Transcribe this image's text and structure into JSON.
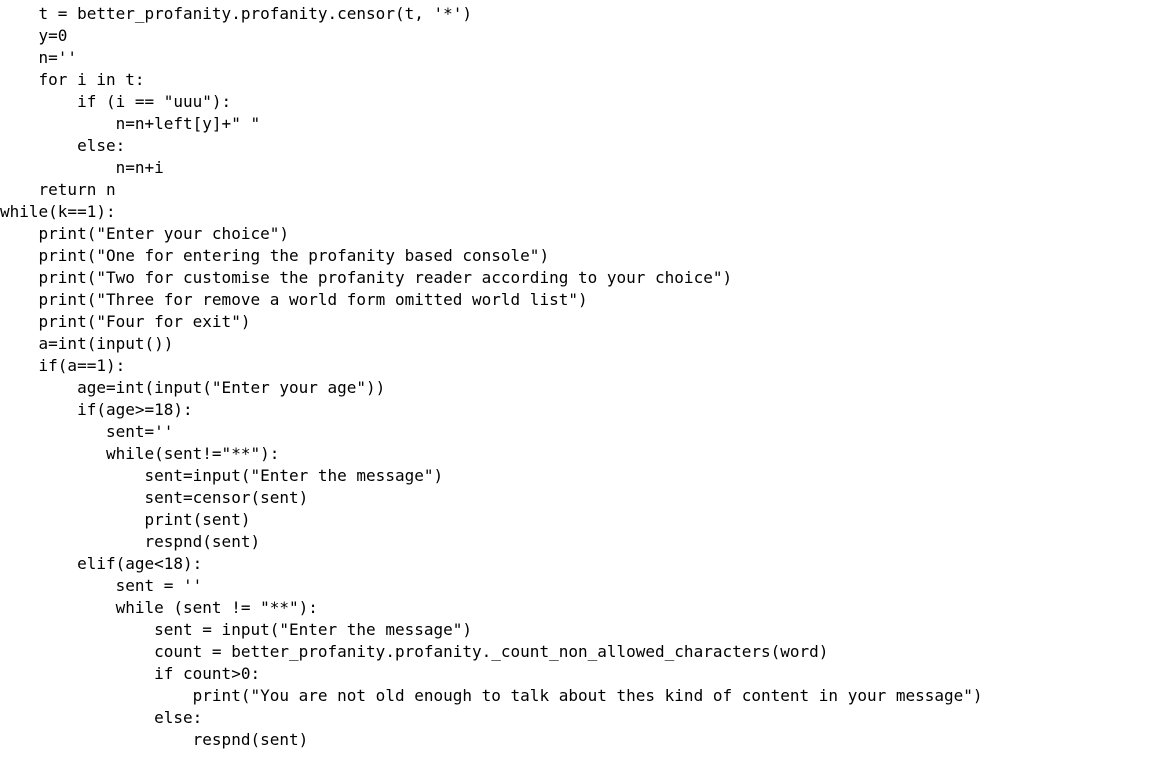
{
  "editor": {
    "lines": [
      "    t = better_profanity.profanity.censor(t, '*')",
      "    y=0",
      "    n=''",
      "    for i in t:",
      "        if (i == \"uuu\"):",
      "            n=n+left[y]+\" \"",
      "        else:",
      "            n=n+i",
      "    return n",
      "while(k==1):",
      "    print(\"Enter your choice\")",
      "    print(\"One for entering the profanity based console\")",
      "    print(\"Two for customise the profanity reader according to your choice\")",
      "    print(\"Three for remove a world form omitted world list\")",
      "    print(\"Four for exit\")",
      "    a=int(input())",
      "    if(a==1):",
      "        age=int(input(\"Enter your age\"))",
      "        if(age>=18):",
      "           sent=''",
      "           while(sent!=\"**\"):",
      "               sent=input(\"Enter the message\")",
      "               sent=censor(sent)",
      "               print(sent)",
      "               respnd(sent)",
      "        elif(age<18):",
      "            sent = ''",
      "            while (sent != \"**\"):",
      "                sent = input(\"Enter the message\")",
      "                count = better_profanity.profanity._count_non_allowed_characters(word)",
      "                if count>0:",
      "                    print(\"You are not old enough to talk about thes kind of content in your message\")",
      "                else:",
      "                    respnd(sent)"
    ]
  }
}
